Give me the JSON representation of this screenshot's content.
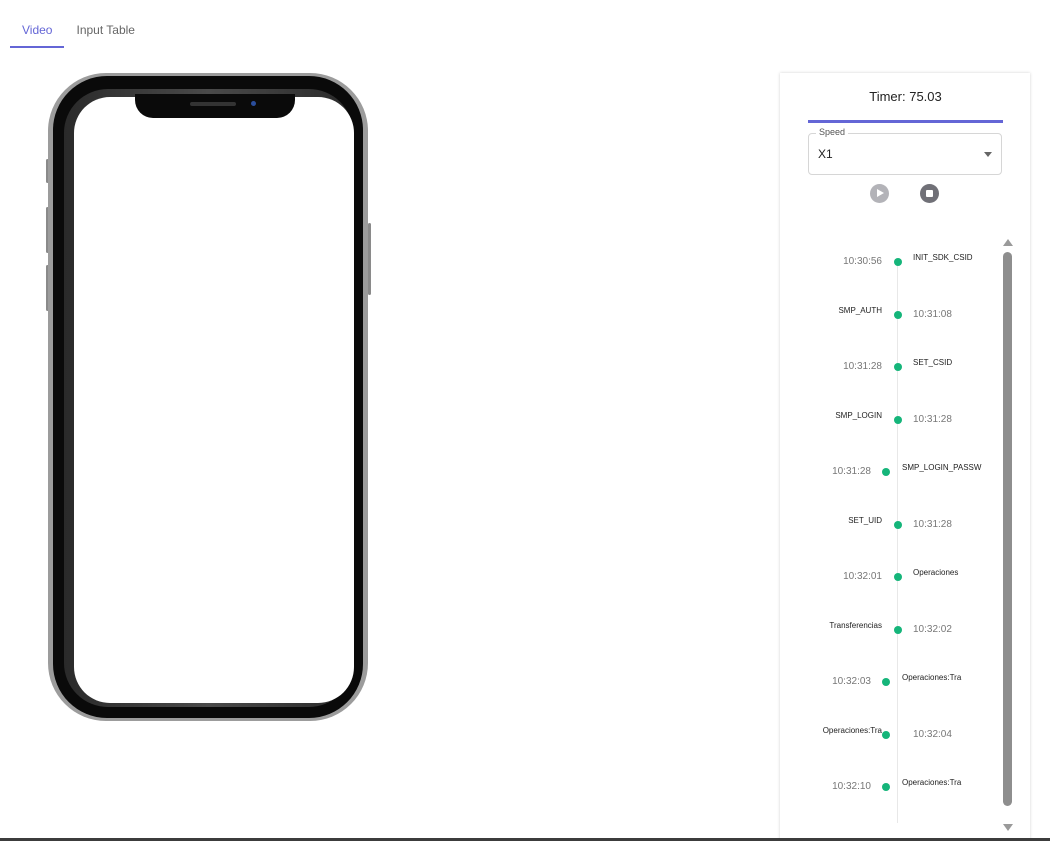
{
  "tabs": [
    {
      "label": "Video",
      "active": true
    },
    {
      "label": "Input Table",
      "active": false
    }
  ],
  "panel": {
    "timer_text": "Timer: 75.03",
    "speed_label": "Speed",
    "speed_value": "X1",
    "controls": {
      "play_icon": "play-icon",
      "stop_icon": "stop-icon"
    }
  },
  "timeline": [
    {
      "side": "right",
      "time": "10:30:56",
      "name": "INIT_SDK_CSID"
    },
    {
      "side": "left",
      "time": "10:31:08",
      "name": "SMP_AUTH"
    },
    {
      "side": "right",
      "time": "10:31:28",
      "name": "SET_CSID"
    },
    {
      "side": "left",
      "time": "10:31:28",
      "name": "SMP_LOGIN"
    },
    {
      "side": "right",
      "time": "10:31:28",
      "name": "SMP_LOGIN_PASSW"
    },
    {
      "side": "left",
      "time": "10:31:28",
      "name": "SET_UID"
    },
    {
      "side": "right",
      "time": "10:32:01",
      "name": "Operaciones"
    },
    {
      "side": "left",
      "time": "10:32:02",
      "name": "Transferencias"
    },
    {
      "side": "right",
      "time": "10:32:03",
      "name": "Operaciones:Tra"
    },
    {
      "side": "left",
      "time": "10:32:04",
      "name": "Operaciones:Tra"
    },
    {
      "side": "right",
      "time": "10:32:10",
      "name": "Operaciones:Tra"
    }
  ],
  "colors": {
    "accent": "#6466d6",
    "dot": "#15b57a"
  }
}
